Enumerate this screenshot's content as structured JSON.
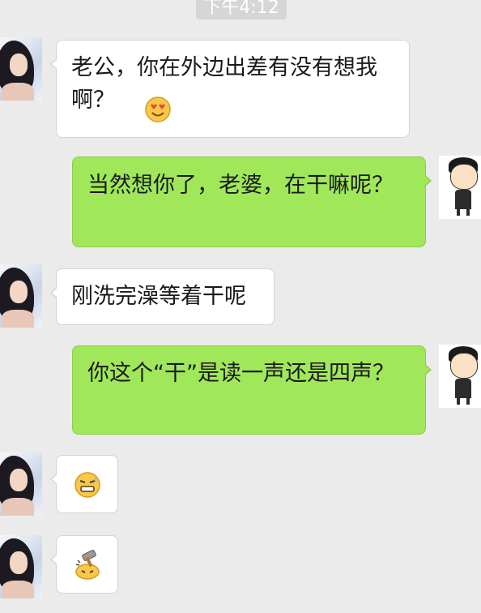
{
  "chat": {
    "timestamp": "下午4:12",
    "messages": [
      {
        "sender": "her",
        "text": "老公，你在外边出差有没有想我啊？",
        "emoji": "heart-eyes-emoji"
      },
      {
        "sender": "him",
        "text": "当然想你了，老婆，在干嘛呢？"
      },
      {
        "sender": "her",
        "text": "刚洗完澡等着干呢"
      },
      {
        "sender": "him",
        "text": "你这个“干”是读一声还是四声？"
      },
      {
        "sender": "her",
        "emoji": "grimace-emoji"
      },
      {
        "sender": "her",
        "emoji": "hammer-knock-emoji"
      }
    ]
  },
  "colors": {
    "background": "#ebebeb",
    "incoming_bubble": "#ffffff",
    "outgoing_bubble": "#a0e75a"
  }
}
